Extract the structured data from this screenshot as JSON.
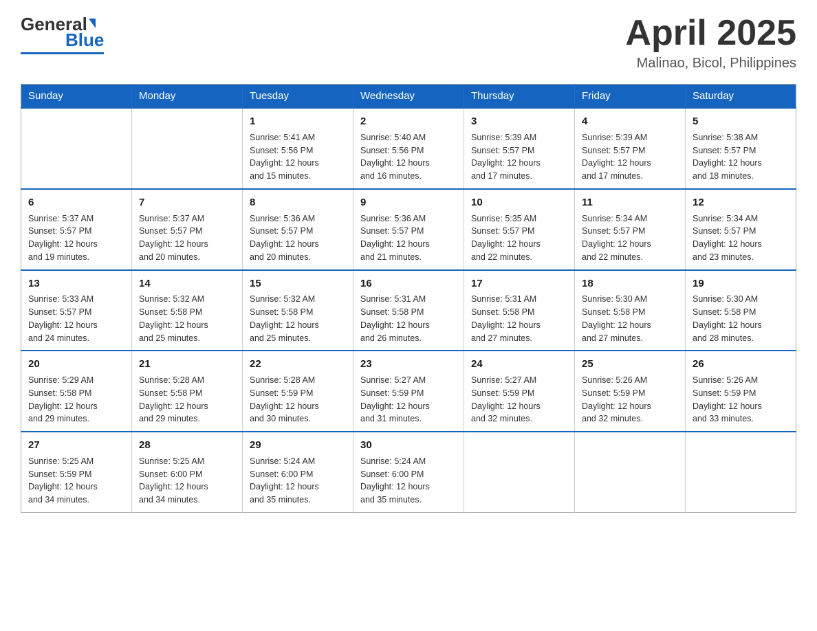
{
  "header": {
    "logo_general": "General",
    "logo_blue": "Blue",
    "month_title": "April 2025",
    "location": "Malinao, Bicol, Philippines"
  },
  "weekdays": [
    "Sunday",
    "Monday",
    "Tuesday",
    "Wednesday",
    "Thursday",
    "Friday",
    "Saturday"
  ],
  "weeks": [
    [
      {
        "day": "",
        "info": ""
      },
      {
        "day": "",
        "info": ""
      },
      {
        "day": "1",
        "info": "Sunrise: 5:41 AM\nSunset: 5:56 PM\nDaylight: 12 hours\nand 15 minutes."
      },
      {
        "day": "2",
        "info": "Sunrise: 5:40 AM\nSunset: 5:56 PM\nDaylight: 12 hours\nand 16 minutes."
      },
      {
        "day": "3",
        "info": "Sunrise: 5:39 AM\nSunset: 5:57 PM\nDaylight: 12 hours\nand 17 minutes."
      },
      {
        "day": "4",
        "info": "Sunrise: 5:39 AM\nSunset: 5:57 PM\nDaylight: 12 hours\nand 17 minutes."
      },
      {
        "day": "5",
        "info": "Sunrise: 5:38 AM\nSunset: 5:57 PM\nDaylight: 12 hours\nand 18 minutes."
      }
    ],
    [
      {
        "day": "6",
        "info": "Sunrise: 5:37 AM\nSunset: 5:57 PM\nDaylight: 12 hours\nand 19 minutes."
      },
      {
        "day": "7",
        "info": "Sunrise: 5:37 AM\nSunset: 5:57 PM\nDaylight: 12 hours\nand 20 minutes."
      },
      {
        "day": "8",
        "info": "Sunrise: 5:36 AM\nSunset: 5:57 PM\nDaylight: 12 hours\nand 20 minutes."
      },
      {
        "day": "9",
        "info": "Sunrise: 5:36 AM\nSunset: 5:57 PM\nDaylight: 12 hours\nand 21 minutes."
      },
      {
        "day": "10",
        "info": "Sunrise: 5:35 AM\nSunset: 5:57 PM\nDaylight: 12 hours\nand 22 minutes."
      },
      {
        "day": "11",
        "info": "Sunrise: 5:34 AM\nSunset: 5:57 PM\nDaylight: 12 hours\nand 22 minutes."
      },
      {
        "day": "12",
        "info": "Sunrise: 5:34 AM\nSunset: 5:57 PM\nDaylight: 12 hours\nand 23 minutes."
      }
    ],
    [
      {
        "day": "13",
        "info": "Sunrise: 5:33 AM\nSunset: 5:57 PM\nDaylight: 12 hours\nand 24 minutes."
      },
      {
        "day": "14",
        "info": "Sunrise: 5:32 AM\nSunset: 5:58 PM\nDaylight: 12 hours\nand 25 minutes."
      },
      {
        "day": "15",
        "info": "Sunrise: 5:32 AM\nSunset: 5:58 PM\nDaylight: 12 hours\nand 25 minutes."
      },
      {
        "day": "16",
        "info": "Sunrise: 5:31 AM\nSunset: 5:58 PM\nDaylight: 12 hours\nand 26 minutes."
      },
      {
        "day": "17",
        "info": "Sunrise: 5:31 AM\nSunset: 5:58 PM\nDaylight: 12 hours\nand 27 minutes."
      },
      {
        "day": "18",
        "info": "Sunrise: 5:30 AM\nSunset: 5:58 PM\nDaylight: 12 hours\nand 27 minutes."
      },
      {
        "day": "19",
        "info": "Sunrise: 5:30 AM\nSunset: 5:58 PM\nDaylight: 12 hours\nand 28 minutes."
      }
    ],
    [
      {
        "day": "20",
        "info": "Sunrise: 5:29 AM\nSunset: 5:58 PM\nDaylight: 12 hours\nand 29 minutes."
      },
      {
        "day": "21",
        "info": "Sunrise: 5:28 AM\nSunset: 5:58 PM\nDaylight: 12 hours\nand 29 minutes."
      },
      {
        "day": "22",
        "info": "Sunrise: 5:28 AM\nSunset: 5:59 PM\nDaylight: 12 hours\nand 30 minutes."
      },
      {
        "day": "23",
        "info": "Sunrise: 5:27 AM\nSunset: 5:59 PM\nDaylight: 12 hours\nand 31 minutes."
      },
      {
        "day": "24",
        "info": "Sunrise: 5:27 AM\nSunset: 5:59 PM\nDaylight: 12 hours\nand 32 minutes."
      },
      {
        "day": "25",
        "info": "Sunrise: 5:26 AM\nSunset: 5:59 PM\nDaylight: 12 hours\nand 32 minutes."
      },
      {
        "day": "26",
        "info": "Sunrise: 5:26 AM\nSunset: 5:59 PM\nDaylight: 12 hours\nand 33 minutes."
      }
    ],
    [
      {
        "day": "27",
        "info": "Sunrise: 5:25 AM\nSunset: 5:59 PM\nDaylight: 12 hours\nand 34 minutes."
      },
      {
        "day": "28",
        "info": "Sunrise: 5:25 AM\nSunset: 6:00 PM\nDaylight: 12 hours\nand 34 minutes."
      },
      {
        "day": "29",
        "info": "Sunrise: 5:24 AM\nSunset: 6:00 PM\nDaylight: 12 hours\nand 35 minutes."
      },
      {
        "day": "30",
        "info": "Sunrise: 5:24 AM\nSunset: 6:00 PM\nDaylight: 12 hours\nand 35 minutes."
      },
      {
        "day": "",
        "info": ""
      },
      {
        "day": "",
        "info": ""
      },
      {
        "day": "",
        "info": ""
      }
    ]
  ]
}
